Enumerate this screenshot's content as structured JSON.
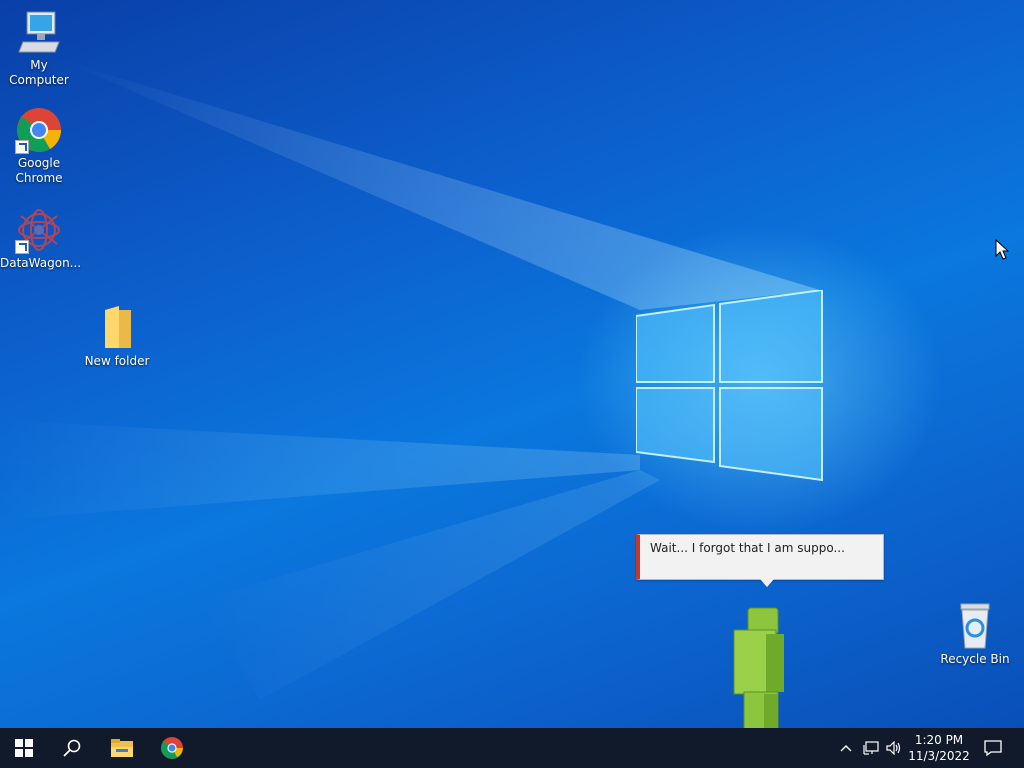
{
  "desktop": {
    "icons": [
      {
        "label": "My Computer"
      },
      {
        "label": "Google Chrome"
      },
      {
        "label": "DataWagon..."
      },
      {
        "label": "New folder"
      },
      {
        "label": "Recycle Bin"
      }
    ]
  },
  "speech_bubble": {
    "text": "Wait... I forgot that I am suppo..."
  },
  "taskbar": {
    "start_icon": "windows-logo-icon",
    "search_icon": "search-icon",
    "pinned": [
      "file-explorer-icon",
      "chrome-icon"
    ],
    "tray": {
      "overflow_icon": "chevron-up-icon",
      "network_icon": "network-icon",
      "volume_icon": "volume-icon",
      "time": "1:20 PM",
      "date": "11/3/2022",
      "notification_icon": "action-center-icon"
    }
  },
  "colors": {
    "desktop_blue": "#0a78de",
    "taskbar_bg": "#101a2a",
    "bubble_accent": "#c0392b",
    "buddy_green": "#8cc63f"
  }
}
